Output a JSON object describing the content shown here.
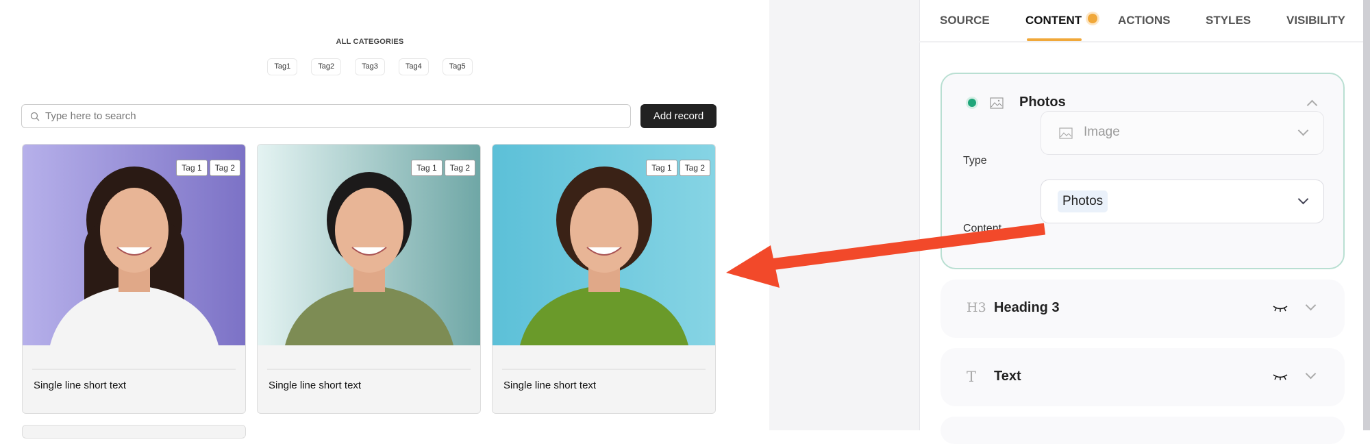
{
  "categories": {
    "title": "ALL CATEGORIES",
    "tags": [
      "Tag1",
      "Tag2",
      "Tag3",
      "Tag4",
      "Tag5"
    ]
  },
  "search": {
    "placeholder": "Type here to search"
  },
  "add_record_label": "Add record",
  "cards": [
    {
      "tags": [
        "Tag 1",
        "Tag 2"
      ],
      "text": "Single line short text",
      "bg": [
        "#b6b0ea",
        "#7c72c6"
      ]
    },
    {
      "tags": [
        "Tag 1",
        "Tag 2"
      ],
      "text": "Single line short text",
      "bg": [
        "#e4f3f2",
        "#6fa7a6"
      ]
    },
    {
      "tags": [
        "Tag 1",
        "Tag 2"
      ],
      "text": "Single line short text",
      "bg": [
        "#5cc0d8",
        "#86d4e4"
      ]
    }
  ],
  "tabs": [
    {
      "label": "SOURCE"
    },
    {
      "label": "CONTENT",
      "active": true,
      "badge": true
    },
    {
      "label": "ACTIONS"
    },
    {
      "label": "STYLES"
    },
    {
      "label": "VISIBILITY"
    }
  ],
  "panel": {
    "photos": {
      "title": "Photos",
      "status_color": "#1fa67a",
      "type_label": "Type",
      "type_value": "Image",
      "content_label": "Content",
      "content_value": "Photos"
    },
    "heading": {
      "icon": "H3",
      "title": "Heading 3"
    },
    "text": {
      "icon": "T",
      "title": "Text"
    }
  },
  "colors": {
    "accent": "#f0a83a",
    "arrow": "#f2492a",
    "button": "#222222"
  }
}
